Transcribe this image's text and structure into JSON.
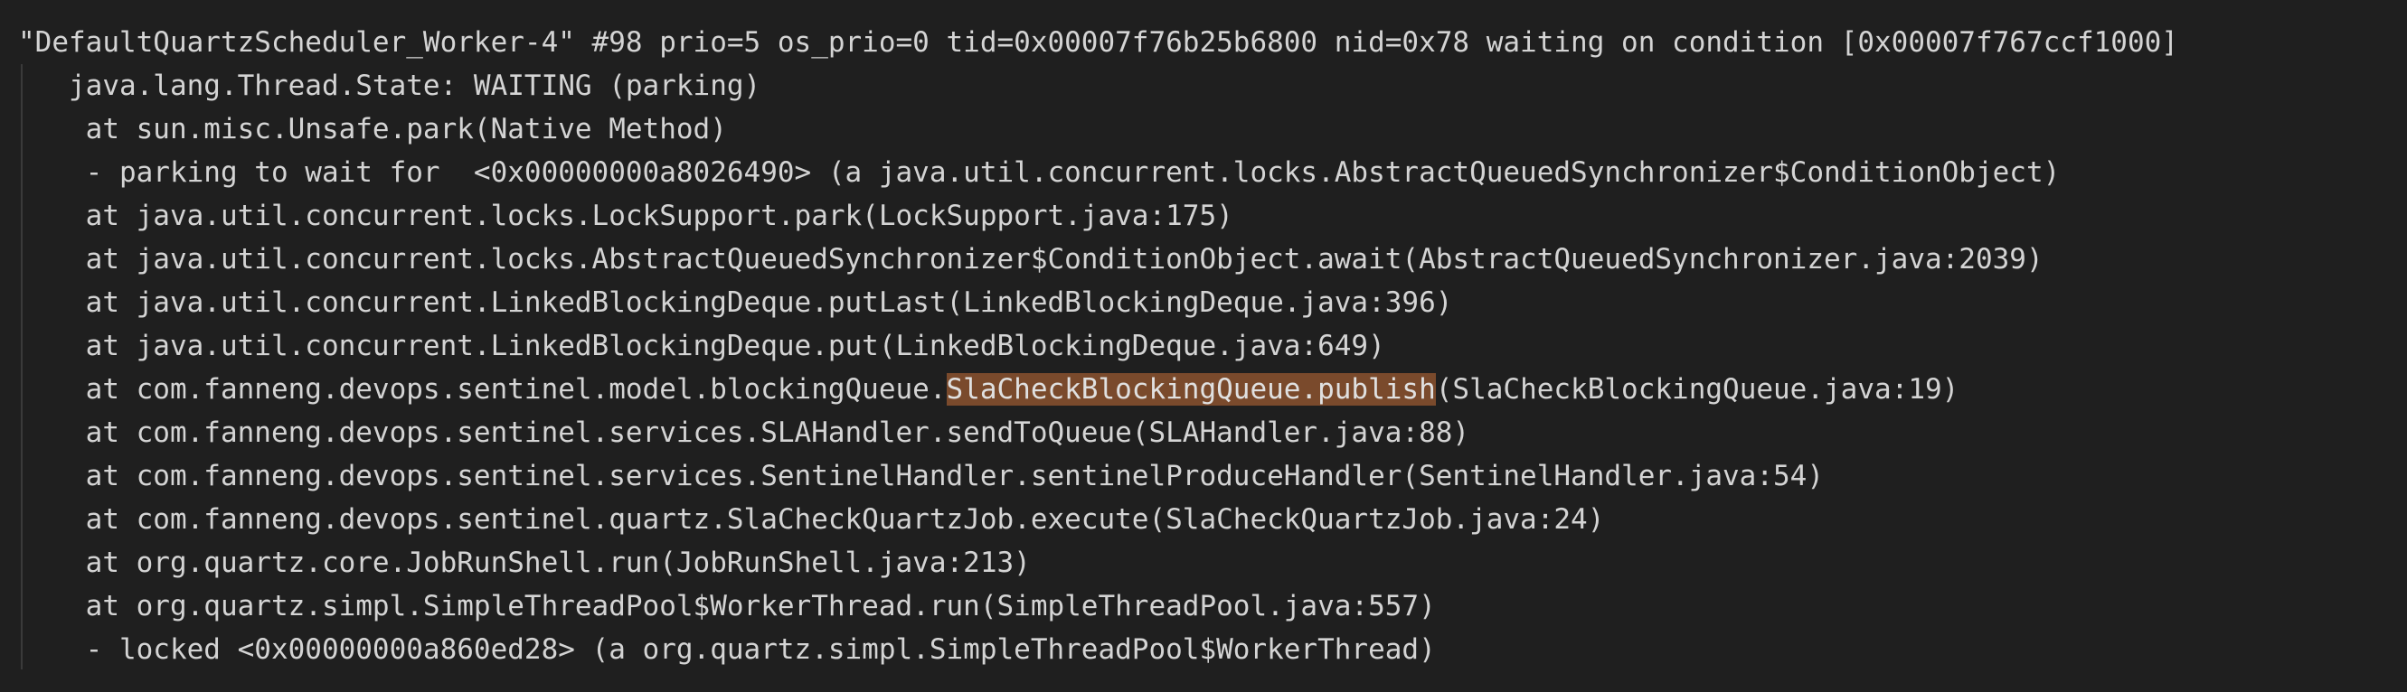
{
  "thread_dump": {
    "header": "\"DefaultQuartzScheduler_Worker-4\" #98 prio=5 os_prio=0 tid=0x00007f76b25b6800 nid=0x78 waiting on condition [0x00007f767ccf1000]",
    "state": "   java.lang.Thread.State: WAITING (parking)",
    "frames": [
      "    at sun.misc.Unsafe.park(Native Method)",
      "    - parking to wait for  <0x00000000a8026490> (a java.util.concurrent.locks.AbstractQueuedSynchronizer$ConditionObject)",
      "    at java.util.concurrent.locks.LockSupport.park(LockSupport.java:175)",
      "    at java.util.concurrent.locks.AbstractQueuedSynchronizer$ConditionObject.await(AbstractQueuedSynchronizer.java:2039)",
      "    at java.util.concurrent.LinkedBlockingDeque.putLast(LinkedBlockingDeque.java:396)",
      "    at java.util.concurrent.LinkedBlockingDeque.put(LinkedBlockingDeque.java:649)"
    ],
    "highlighted_frame": {
      "before": "    at com.fanneng.devops.sentinel.model.blockingQueue.",
      "match": "SlaCheckBlockingQueue.publish",
      "after": "(SlaCheckBlockingQueue.java:19)"
    },
    "frames_after": [
      "    at com.fanneng.devops.sentinel.services.SLAHandler.sendToQueue(SLAHandler.java:88)",
      "    at com.fanneng.devops.sentinel.services.SentinelHandler.sentinelProduceHandler(SentinelHandler.java:54)",
      "    at com.fanneng.devops.sentinel.quartz.SlaCheckQuartzJob.execute(SlaCheckQuartzJob.java:24)",
      "    at org.quartz.core.JobRunShell.run(JobRunShell.java:213)",
      "    at org.quartz.simpl.SimpleThreadPool$WorkerThread.run(SimpleThreadPool.java:557)",
      "    - locked <0x00000000a860ed28> (a org.quartz.simpl.SimpleThreadPool$WorkerThread)"
    ]
  },
  "colors": {
    "background": "#1f1f1f",
    "text": "#d4d4d4",
    "search_highlight": "#7a4a2c",
    "indent_guide": "#3a3a3a"
  }
}
